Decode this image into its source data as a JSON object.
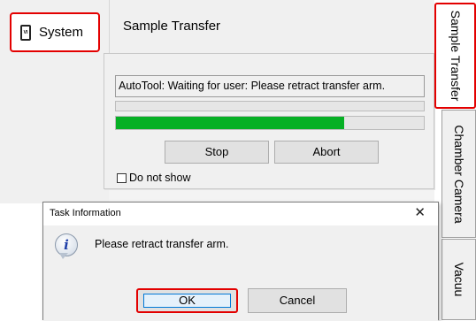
{
  "sidebar": {
    "system_label": "System",
    "system_icon_text": "VI",
    "system_icon": "device-icon"
  },
  "header": {
    "title": "Sample Transfer"
  },
  "progress": {
    "status_text": "AutoTool: Waiting for user: Please retract transfer arm.",
    "bar_fraction": 0.74,
    "bar_color": "#06b025",
    "stop_label": "Stop",
    "abort_label": "Abort",
    "do_not_show_label": "Do not show",
    "do_not_show_checked": false
  },
  "tabs": [
    {
      "label": "Sample Transfer",
      "selected": true
    },
    {
      "label": "Chamber Camera"
    },
    {
      "label": "Vacuu"
    }
  ],
  "dialog": {
    "title": "Task Information",
    "close_glyph": "✕",
    "icon": "info-icon",
    "icon_glyph": "i",
    "message": "Please retract transfer arm.",
    "ok_label": "OK",
    "cancel_label": "Cancel"
  },
  "colors": {
    "highlight": "#e30000",
    "progress": "#06b025",
    "window_bg": "#f0f0f0"
  }
}
